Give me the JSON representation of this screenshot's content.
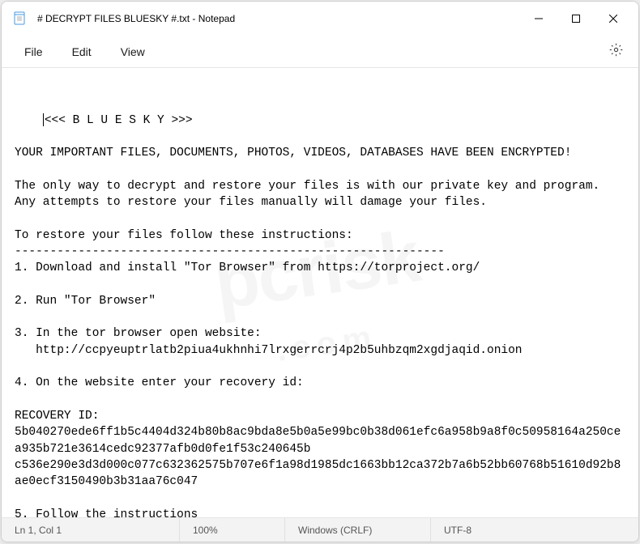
{
  "window": {
    "title": "# DECRYPT FILES BLUESKY #.txt - Notepad"
  },
  "menu": {
    "file": "File",
    "edit": "Edit",
    "view": "View"
  },
  "editor": {
    "content": "<<< B L U E S K Y >>>\n\nYOUR IMPORTANT FILES, DOCUMENTS, PHOTOS, VIDEOS, DATABASES HAVE BEEN ENCRYPTED!\n\nThe only way to decrypt and restore your files is with our private key and program.\nAny attempts to restore your files manually will damage your files.\n\nTo restore your files follow these instructions:\n-------------------------------------------------------------\n1. Download and install \"Tor Browser\" from https://torproject.org/\n\n2. Run \"Tor Browser\"\n\n3. In the tor browser open website:\n   http://ccpyeuptrlatb2piua4ukhnhi7lrxgerrcrj4p2b5uhbzqm2xgdjaqid.onion\n\n4. On the website enter your recovery id:\n\nRECOVERY ID: 5b040270ede6ff1b5c4404d324b80b8ac9bda8e5b0a5e99bc0b38d061efc6a958b9a8f0c50958164a250cea935b721e3614cedc92377afb0d0fe1f53c240645b\nc536e290e3d3d000c077c632362575b707e6f1a98d1985dc1663bb12ca372b7a6b52bb60768b51610d92b8ae0ecf3150490b3b31aa76c047\n\n5. Follow the instructions"
  },
  "statusbar": {
    "position": "Ln 1, Col 1",
    "zoom": "100%",
    "line_ending": "Windows (CRLF)",
    "encoding": "UTF-8"
  },
  "watermark": {
    "top": "pcrisk",
    "bottom": ".com"
  }
}
